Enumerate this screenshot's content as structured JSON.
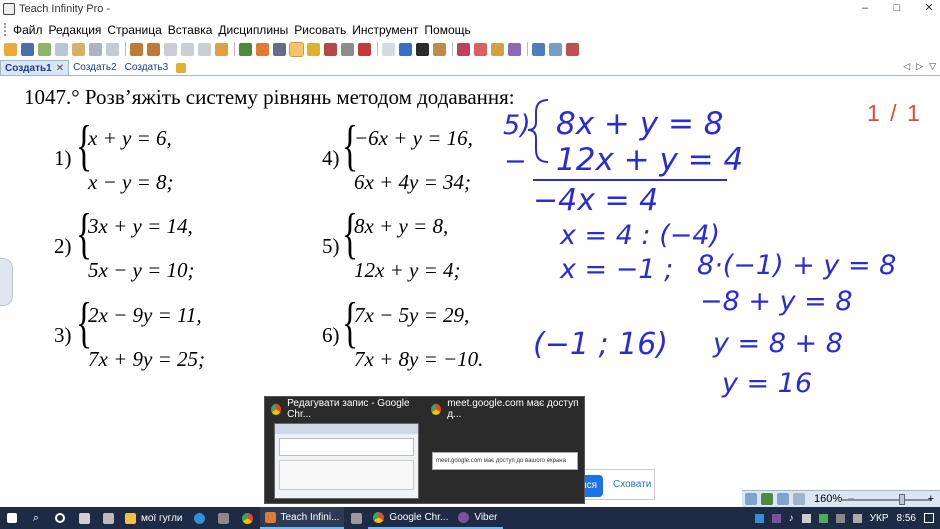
{
  "window": {
    "title": "Teach Infinity Pro -",
    "min": "–",
    "max": "□",
    "close": "✕"
  },
  "menu": [
    "Файл",
    "Редакция",
    "Страница",
    "Вставка",
    "Дисциплины",
    "Рисовать",
    "Инструмент",
    "Помощь"
  ],
  "tabs": [
    {
      "label": "Создать1",
      "close": "✕"
    },
    {
      "label": "Создать2"
    },
    {
      "label": "Создать3"
    }
  ],
  "tabnav": {
    "prev": "◁",
    "next": "▷",
    "menu": "▽"
  },
  "page": {
    "indicator": "1 / 1"
  },
  "textbook": {
    "heading": "1047.° Розв’яжіть систему рівнянь методом додавання:",
    "systems": [
      {
        "label": "1)",
        "eq1": "x + y = 6,",
        "eq2": "x − y = 8;"
      },
      {
        "label": "2)",
        "eq1": "3x + y = 14,",
        "eq2": "5x − y = 10;"
      },
      {
        "label": "3)",
        "eq1": "2x − 9y = 11,",
        "eq2": "7x + 9y = 25;"
      },
      {
        "label": "4)",
        "eq1": "−6x + y = 16,",
        "eq2": "6x + 4y = 34;"
      },
      {
        "label": "5)",
        "eq1": "8x + y = 8,",
        "eq2": "12x + y = 4;"
      },
      {
        "label": "6)",
        "eq1": "7x − 5y = 29,",
        "eq2": "7x + 8y = −10."
      }
    ]
  },
  "handwriting": {
    "label": "5)",
    "eq1": "8x + y = 8",
    "minus": "−",
    "eq2": "12x + y = 4",
    "diff": "−4x = 4",
    "x1": "x = 4 : (−4)",
    "x2": "x = −1 ;",
    "sub": "8·(−1) + y = 8",
    "s2": "−8 + y = 8",
    "s3": "y = 8 + 8",
    "s4": "y = 16",
    "answer": "(−1 ; 16)"
  },
  "taskpreview": {
    "item1": "Редагувати запис - Google Chr...",
    "item2": "meet.google.com має доступ д...",
    "mini_text": "meet.google.com має доступ до вашого екрана"
  },
  "notification": {
    "allow": "ися",
    "deny": "Сховати"
  },
  "zoom": {
    "value": "160%",
    "minus": "–",
    "plus": "+"
  },
  "taskbar": {
    "folder": "мої гугли",
    "teach": "Teach Infini...",
    "chrome": "Google Chr...",
    "viber": "Viber",
    "lang": "УКР",
    "time": "8:56"
  },
  "colors": {
    "ink": "#2b2bd6",
    "page_indicator": "#e0473b",
    "taskbar": "#1f2a44"
  },
  "icons": [
    "pencil-icon",
    "save-icon",
    "undo-icon",
    "redo-icon",
    "pen-icon",
    "text-icon",
    "eraser-icon",
    "chrome-icon",
    "search-icon",
    "windows-icon"
  ]
}
